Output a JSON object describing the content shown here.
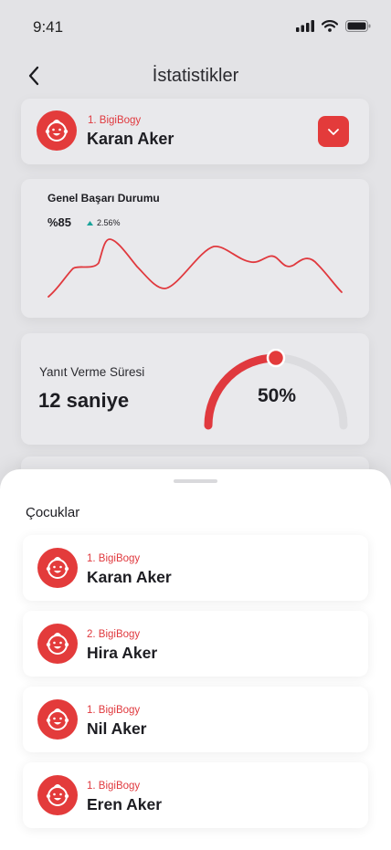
{
  "status_bar": {
    "time": "9:41"
  },
  "header": {
    "title": "İstatistikler"
  },
  "selected_child": {
    "rank": "1.  BigiBogy",
    "name": "Karan Aker"
  },
  "overall": {
    "title": "Genel Başarı Durumu",
    "value": "%85",
    "delta": "2.56%"
  },
  "response": {
    "label": "Yanıt Verme Süresi",
    "value": "12 saniye",
    "percent_label": "50%",
    "percent": 50
  },
  "sheet": {
    "title": "Çocuklar",
    "children": [
      {
        "rank": "1.  BigiBogy",
        "name": "Karan Aker"
      },
      {
        "rank": "2.  BigiBogy",
        "name": "Hira Aker"
      },
      {
        "rank": "1.  BigiBogy",
        "name": "Nil Aker"
      },
      {
        "rank": "1.  BigiBogy",
        "name": "Eren Aker"
      }
    ]
  },
  "colors": {
    "accent": "#e33b3b",
    "trend_up": "#1aa39a",
    "background": "#e3e3e6"
  }
}
